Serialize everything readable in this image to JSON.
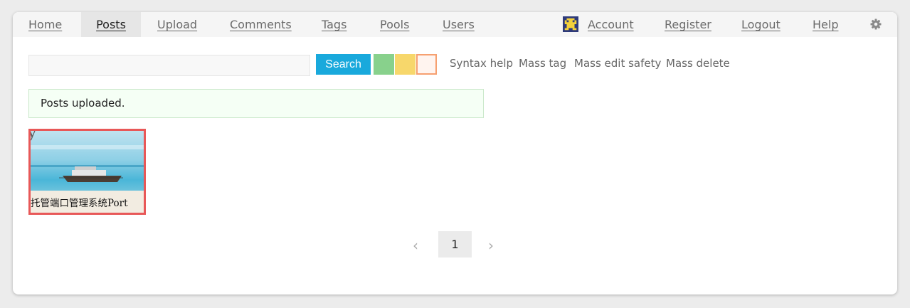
{
  "nav": {
    "home": "Home",
    "posts": "Posts",
    "upload": "Upload",
    "comments": "Comments",
    "tags": "Tags",
    "pools": "Pools",
    "users": "Users",
    "account": "Account",
    "register": "Register",
    "logout": "Logout",
    "help": "Help",
    "settings_icon": "gear-icon"
  },
  "search": {
    "value": "",
    "placeholder": "",
    "button_label": "Search"
  },
  "swatches": {
    "green": "#88d18c",
    "yellow": "#f7d76b",
    "orange_outline": "#f6a070"
  },
  "tools": {
    "syntax_help": "Syntax help",
    "mass_tag": "Mass tag",
    "mass_edit_safety": "Mass edit safety",
    "mass_delete": "Mass delete"
  },
  "message": {
    "text": "Posts uploaded."
  },
  "post": {
    "caption": "托管端口管理系统Port",
    "corner_letter": "y",
    "selected_border_color": "#e85858"
  },
  "pagination": {
    "prev": "‹",
    "current": "1",
    "next": "›"
  },
  "colors": {
    "accent": "#19a9dc",
    "message_bg": "#f5fff5"
  }
}
